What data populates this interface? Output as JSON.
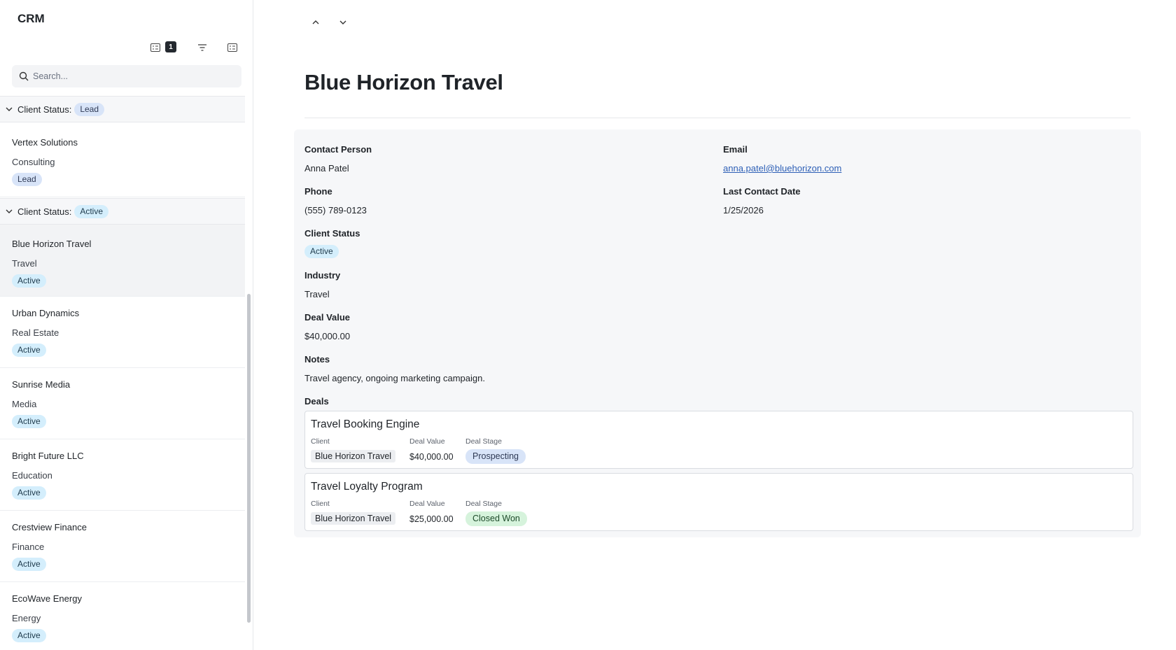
{
  "app": {
    "title": "CRM"
  },
  "toolbar": {
    "group_count": "1"
  },
  "search": {
    "placeholder": "Search..."
  },
  "groups": [
    {
      "label": "Client Status:",
      "value": "Lead"
    },
    {
      "label": "Client Status:",
      "value": "Active"
    }
  ],
  "clients": [
    {
      "name": "Vertex Solutions",
      "industry": "Consulting",
      "status": "Lead"
    },
    {
      "name": "Blue Horizon Travel",
      "industry": "Travel",
      "status": "Active"
    },
    {
      "name": "Urban Dynamics",
      "industry": "Real Estate",
      "status": "Active"
    },
    {
      "name": "Sunrise Media",
      "industry": "Media",
      "status": "Active"
    },
    {
      "name": "Bright Future LLC",
      "industry": "Education",
      "status": "Active"
    },
    {
      "name": "Crestview Finance",
      "industry": "Finance",
      "status": "Active"
    },
    {
      "name": "EcoWave Energy",
      "industry": "Energy",
      "status": "Active"
    }
  ],
  "record": {
    "title": "Blue Horizon Travel",
    "contact_person_label": "Contact Person",
    "contact_person": "Anna Patel",
    "email_label": "Email",
    "email": "anna.patel@bluehorizon.com",
    "phone_label": "Phone",
    "phone": "(555) 789-0123",
    "last_contact_label": "Last Contact Date",
    "last_contact": "1/25/2026",
    "status_label": "Client Status",
    "status": "Active",
    "industry_label": "Industry",
    "industry": "Travel",
    "deal_value_label": "Deal Value",
    "deal_value": "$40,000.00",
    "notes_label": "Notes",
    "notes": "Travel agency, ongoing marketing campaign.",
    "deals_label": "Deals"
  },
  "deals": [
    {
      "title": "Travel Booking Engine",
      "client_label": "Client",
      "value_label": "Deal Value",
      "stage_label": "Deal Stage",
      "client": "Blue Horizon Travel",
      "value": "$40,000.00",
      "stage": "Prospecting"
    },
    {
      "title": "Travel Loyalty Program",
      "client_label": "Client",
      "value_label": "Deal Value",
      "stage_label": "Deal Stage",
      "client": "Blue Horizon Travel",
      "value": "$25,000.00",
      "stage": "Closed Won"
    }
  ],
  "colors": {
    "active": "#d4eefc",
    "lead": "#d8e4f8",
    "closed_won": "#d6f3dc",
    "link": "#2d5fb6"
  }
}
